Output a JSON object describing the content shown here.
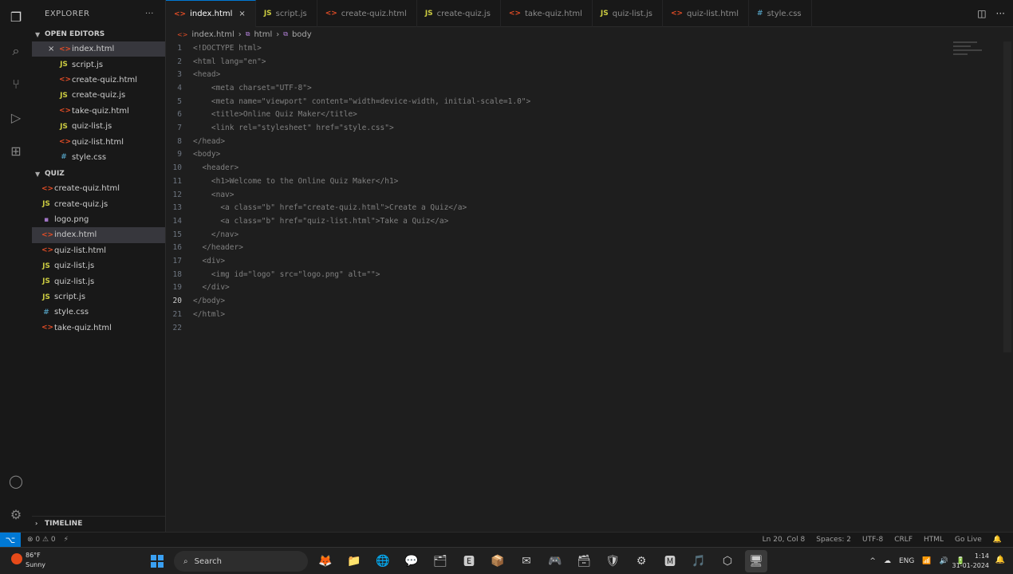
{
  "colors": {
    "accent": "#0078d4",
    "editor_bg": "#1e1e1e",
    "sidebar_bg": "#181818",
    "html_icon": "#e44d26",
    "js_icon": "#cbcb41",
    "css_icon": "#519aba"
  },
  "activity_bar": {
    "icons": [
      "files-icon",
      "search-icon",
      "source-control-icon",
      "run-debug-icon",
      "extensions-icon",
      "account-icon",
      "settings-gear-icon"
    ]
  },
  "sidebar": {
    "title": "EXPLORER",
    "more_label": "···",
    "open_editors": {
      "title": "OPEN EDITORS",
      "items": [
        {
          "label": "index.html",
          "icon": "html",
          "glyph": "<>",
          "close": "×",
          "selected": true
        },
        {
          "label": "script.js",
          "icon": "js",
          "glyph": "JS"
        },
        {
          "label": "create-quiz.html",
          "icon": "html",
          "glyph": "<>"
        },
        {
          "label": "create-quiz.js",
          "icon": "js",
          "glyph": "JS"
        },
        {
          "label": "take-quiz.html",
          "icon": "html",
          "glyph": "<>"
        },
        {
          "label": "quiz-list.js",
          "icon": "js",
          "glyph": "JS"
        },
        {
          "label": "quiz-list.html",
          "icon": "html",
          "glyph": "<>"
        },
        {
          "label": "style.css",
          "icon": "css",
          "glyph": "#"
        }
      ]
    },
    "workspace": {
      "title": "QUIZ",
      "items": [
        {
          "label": "create-quiz.html",
          "icon": "html",
          "glyph": "<>"
        },
        {
          "label": "create-quiz.js",
          "icon": "js",
          "glyph": "JS"
        },
        {
          "label": "logo.png",
          "icon": "img",
          "glyph": "▪"
        },
        {
          "label": "index.html",
          "icon": "html",
          "glyph": "<>",
          "selected": true
        },
        {
          "label": "quiz-list.html",
          "icon": "html",
          "glyph": "<>"
        },
        {
          "label": "quiz-list.js",
          "icon": "js",
          "glyph": "JS"
        },
        {
          "label": "quiz-list.js",
          "icon": "js",
          "glyph": "JS"
        },
        {
          "label": "script.js",
          "icon": "js",
          "glyph": "JS"
        },
        {
          "label": "style.css",
          "icon": "css",
          "glyph": "#"
        },
        {
          "label": "take-quiz.html",
          "icon": "html",
          "glyph": "<>"
        }
      ]
    },
    "timeline_title": "TIMELINE"
  },
  "tabs": [
    {
      "label": "index.html",
      "icon": "html",
      "glyph": "<>",
      "active": true,
      "close": "×"
    },
    {
      "label": "script.js",
      "icon": "js",
      "glyph": "JS"
    },
    {
      "label": "create-quiz.html",
      "icon": "html",
      "glyph": "<>"
    },
    {
      "label": "create-quiz.js",
      "icon": "js",
      "glyph": "JS"
    },
    {
      "label": "take-quiz.html",
      "icon": "html",
      "glyph": "<>"
    },
    {
      "label": "quiz-list.js",
      "icon": "js",
      "glyph": "JS"
    },
    {
      "label": "quiz-list.html",
      "icon": "html",
      "glyph": "<>"
    },
    {
      "label": "style.css",
      "icon": "css",
      "glyph": "#"
    }
  ],
  "tab_actions": {
    "split": "◫",
    "more": "···"
  },
  "breadcrumb": [
    "index.html",
    "html",
    "body"
  ],
  "editor": {
    "current_line": 20,
    "lines": [
      {
        "n": "1",
        "text": "<!DOCTYPE html>"
      },
      {
        "n": "2",
        "text": "<html lang=\"en\">"
      },
      {
        "n": "3",
        "text": "<head>"
      },
      {
        "n": "4",
        "text": "    <meta charset=\"UTF-8\">"
      },
      {
        "n": "5",
        "text": "    <meta name=\"viewport\" content=\"width=device-width, initial-scale=1.0\">"
      },
      {
        "n": "6",
        "text": "    <title>Online Quiz Maker</title>"
      },
      {
        "n": "7",
        "text": "    <link rel=\"stylesheet\" href=\"style.css\">"
      },
      {
        "n": "8",
        "text": "</head>"
      },
      {
        "n": "9",
        "text": "<body>"
      },
      {
        "n": "10",
        "text": "  <header>"
      },
      {
        "n": "11",
        "text": "    <h1>Welcome to the Online Quiz Maker</h1>"
      },
      {
        "n": "12",
        "text": "    <nav>"
      },
      {
        "n": "13",
        "text": "      <a class=\"b\" href=\"create-quiz.html\">Create a Quiz</a>"
      },
      {
        "n": "14",
        "text": "      <a class=\"b\" href=\"quiz-list.html\">Take a Quiz</a>"
      },
      {
        "n": "15",
        "text": "    </nav>"
      },
      {
        "n": "16",
        "text": "  </header>"
      },
      {
        "n": "17",
        "text": "  <div>"
      },
      {
        "n": "18",
        "text": "    <img id=\"logo\" src=\"logo.png\" alt=\"\">"
      },
      {
        "n": "19",
        "text": "  </div>"
      },
      {
        "n": "20",
        "text": "</body>"
      },
      {
        "n": "21",
        "text": "</html>"
      },
      {
        "n": "22",
        "text": ""
      }
    ]
  },
  "statusbar": {
    "remote": "⌥",
    "left": [
      "⊗ 0 ⚠ 0",
      "⚡"
    ],
    "right": [
      "Ln 20, Col 8",
      "Spaces: 2",
      "UTF-8",
      "CRLF",
      "HTML",
      "Go Live",
      "🔔"
    ]
  },
  "taskbar": {
    "weather_temp": "86°F",
    "weather_desc": "Sunny",
    "search_label": "Search",
    "apps": [
      "🦊",
      "📁",
      "🌐",
      "💬",
      "🗂",
      "🅴",
      "📦",
      "✉",
      "🎮",
      "🗃",
      "🛡",
      "⚙",
      "🅼",
      "🎵",
      "⬡",
      "🖥"
    ],
    "tray": [
      "^",
      "☁",
      "ENG",
      "📶",
      "🔊",
      "🔋"
    ],
    "time": "1:14",
    "date": "31-01-2024"
  }
}
